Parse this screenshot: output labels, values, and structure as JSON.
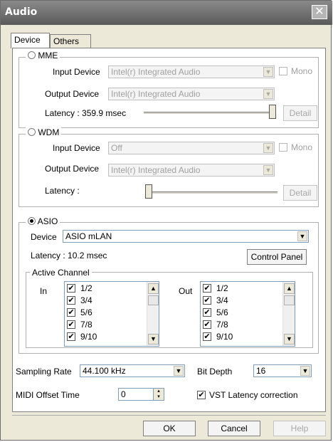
{
  "window": {
    "title": "Audio"
  },
  "tabs": [
    {
      "label": "Device",
      "active": true
    },
    {
      "label": "Others",
      "active": false
    }
  ],
  "mme": {
    "label": "MME",
    "input_label": "Input Device",
    "input_value": "Intel(r) Integrated Audio",
    "mono_label": "Mono",
    "output_label": "Output Device",
    "output_value": "Intel(r) Integrated Audio",
    "latency_text": "Latency : 359.9 msec",
    "slider_level": 1.0,
    "detail_label": "Detail"
  },
  "wdm": {
    "label": "WDM",
    "input_label": "Input Device",
    "input_value": "Off",
    "mono_label": "Mono",
    "output_label": "Output Device",
    "output_value": "Intel(r) Integrated Audio",
    "latency_text": "Latency :",
    "slider_level": 0.0,
    "detail_label": "Detail"
  },
  "asio": {
    "label": "ASIO",
    "device_label": "Device",
    "device_value": "ASIO mLAN",
    "latency_text": "Latency :  10.2 msec",
    "control_panel_label": "Control Panel",
    "active_channel_label": "Active Channel",
    "in_label": "In",
    "out_label": "Out",
    "in_channels": [
      "1/2",
      "3/4",
      "5/6",
      "7/8",
      "9/10"
    ],
    "out_channels": [
      "1/2",
      "3/4",
      "5/6",
      "7/8",
      "9/10"
    ]
  },
  "settings": {
    "sampling_rate_label": "Sampling Rate",
    "sampling_rate_value": "44.100 kHz",
    "bit_depth_label": "Bit Depth",
    "bit_depth_value": "16",
    "midi_offset_label": "MIDI Offset Time",
    "midi_offset_value": "0",
    "vst_latency_label": "VST Latency correction"
  },
  "buttons": {
    "ok": "OK",
    "cancel": "Cancel",
    "help": "Help"
  },
  "glyphs": {
    "check": "✔",
    "arrow_down": "▼",
    "arrow_up": "▲",
    "close": "✕",
    "spin_up": "▴",
    "spin_down": "▾"
  }
}
